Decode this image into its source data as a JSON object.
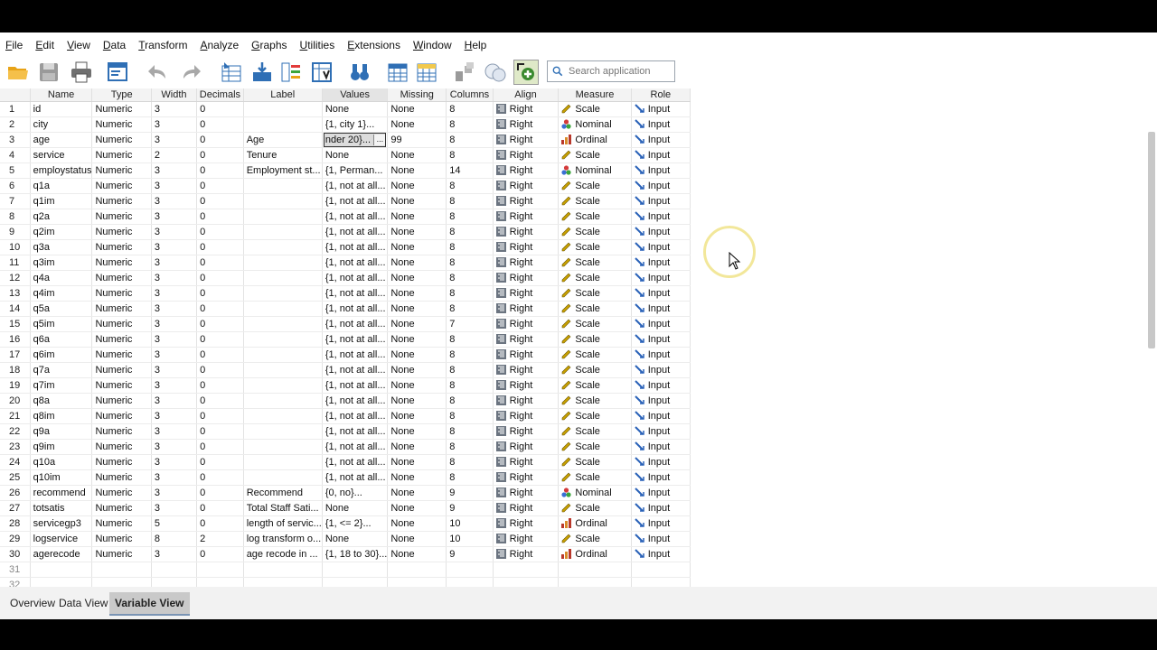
{
  "menu": [
    "File",
    "Edit",
    "View",
    "Data",
    "Transform",
    "Analyze",
    "Graphs",
    "Utilities",
    "Extensions",
    "Window",
    "Help"
  ],
  "search": {
    "placeholder": "Search application"
  },
  "columns": [
    "Name",
    "Type",
    "Width",
    "Decimals",
    "Label",
    "Values",
    "Missing",
    "Columns",
    "Align",
    "Measure",
    "Role"
  ],
  "rows": [
    {
      "n": "1",
      "name": "id",
      "type": "Numeric",
      "width": "3",
      "decimals": "0",
      "label": "",
      "values": "None",
      "missing": "None",
      "columns": "8",
      "align": "Right",
      "measure": "Scale",
      "role": "Input"
    },
    {
      "n": "2",
      "name": "city",
      "type": "Numeric",
      "width": "3",
      "decimals": "0",
      "label": "",
      "values": "{1, city 1}...",
      "missing": "None",
      "columns": "8",
      "align": "Right",
      "measure": "Nominal",
      "role": "Input"
    },
    {
      "n": "3",
      "name": "age",
      "type": "Numeric",
      "width": "3",
      "decimals": "0",
      "label": "Age",
      "values": "nder 20}...",
      "missing": "99",
      "columns": "8",
      "align": "Right",
      "measure": "Ordinal",
      "role": "Input"
    },
    {
      "n": "4",
      "name": "service",
      "type": "Numeric",
      "width": "2",
      "decimals": "0",
      "label": "Tenure",
      "values": "None",
      "missing": "None",
      "columns": "8",
      "align": "Right",
      "measure": "Scale",
      "role": "Input"
    },
    {
      "n": "5",
      "name": "employstatus",
      "type": "Numeric",
      "width": "3",
      "decimals": "0",
      "label": "Employment st...",
      "values": "{1, Perman...",
      "missing": "None",
      "columns": "14",
      "align": "Right",
      "measure": "Nominal",
      "role": "Input"
    },
    {
      "n": "6",
      "name": "q1a",
      "type": "Numeric",
      "width": "3",
      "decimals": "0",
      "label": "",
      "values": "{1, not at all...",
      "missing": "None",
      "columns": "8",
      "align": "Right",
      "measure": "Scale",
      "role": "Input"
    },
    {
      "n": "7",
      "name": "q1im",
      "type": "Numeric",
      "width": "3",
      "decimals": "0",
      "label": "",
      "values": "{1, not at all...",
      "missing": "None",
      "columns": "8",
      "align": "Right",
      "measure": "Scale",
      "role": "Input"
    },
    {
      "n": "8",
      "name": "q2a",
      "type": "Numeric",
      "width": "3",
      "decimals": "0",
      "label": "",
      "values": "{1, not at all...",
      "missing": "None",
      "columns": "8",
      "align": "Right",
      "measure": "Scale",
      "role": "Input"
    },
    {
      "n": "9",
      "name": "q2im",
      "type": "Numeric",
      "width": "3",
      "decimals": "0",
      "label": "",
      "values": "{1, not at all...",
      "missing": "None",
      "columns": "8",
      "align": "Right",
      "measure": "Scale",
      "role": "Input"
    },
    {
      "n": "10",
      "name": "q3a",
      "type": "Numeric",
      "width": "3",
      "decimals": "0",
      "label": "",
      "values": "{1, not at all...",
      "missing": "None",
      "columns": "8",
      "align": "Right",
      "measure": "Scale",
      "role": "Input"
    },
    {
      "n": "11",
      "name": "q3im",
      "type": "Numeric",
      "width": "3",
      "decimals": "0",
      "label": "",
      "values": "{1, not at all...",
      "missing": "None",
      "columns": "8",
      "align": "Right",
      "measure": "Scale",
      "role": "Input"
    },
    {
      "n": "12",
      "name": "q4a",
      "type": "Numeric",
      "width": "3",
      "decimals": "0",
      "label": "",
      "values": "{1, not at all...",
      "missing": "None",
      "columns": "8",
      "align": "Right",
      "measure": "Scale",
      "role": "Input"
    },
    {
      "n": "13",
      "name": "q4im",
      "type": "Numeric",
      "width": "3",
      "decimals": "0",
      "label": "",
      "values": "{1, not at all...",
      "missing": "None",
      "columns": "8",
      "align": "Right",
      "measure": "Scale",
      "role": "Input"
    },
    {
      "n": "14",
      "name": "q5a",
      "type": "Numeric",
      "width": "3",
      "decimals": "0",
      "label": "",
      "values": "{1, not at all...",
      "missing": "None",
      "columns": "8",
      "align": "Right",
      "measure": "Scale",
      "role": "Input"
    },
    {
      "n": "15",
      "name": "q5im",
      "type": "Numeric",
      "width": "3",
      "decimals": "0",
      "label": "",
      "values": "{1, not at all...",
      "missing": "None",
      "columns": "7",
      "align": "Right",
      "measure": "Scale",
      "role": "Input"
    },
    {
      "n": "16",
      "name": "q6a",
      "type": "Numeric",
      "width": "3",
      "decimals": "0",
      "label": "",
      "values": "{1, not at all...",
      "missing": "None",
      "columns": "8",
      "align": "Right",
      "measure": "Scale",
      "role": "Input"
    },
    {
      "n": "17",
      "name": "q6im",
      "type": "Numeric",
      "width": "3",
      "decimals": "0",
      "label": "",
      "values": "{1, not at all...",
      "missing": "None",
      "columns": "8",
      "align": "Right",
      "measure": "Scale",
      "role": "Input"
    },
    {
      "n": "18",
      "name": "q7a",
      "type": "Numeric",
      "width": "3",
      "decimals": "0",
      "label": "",
      "values": "{1, not at all...",
      "missing": "None",
      "columns": "8",
      "align": "Right",
      "measure": "Scale",
      "role": "Input"
    },
    {
      "n": "19",
      "name": "q7im",
      "type": "Numeric",
      "width": "3",
      "decimals": "0",
      "label": "",
      "values": "{1, not at all...",
      "missing": "None",
      "columns": "8",
      "align": "Right",
      "measure": "Scale",
      "role": "Input"
    },
    {
      "n": "20",
      "name": "q8a",
      "type": "Numeric",
      "width": "3",
      "decimals": "0",
      "label": "",
      "values": "{1, not at all...",
      "missing": "None",
      "columns": "8",
      "align": "Right",
      "measure": "Scale",
      "role": "Input"
    },
    {
      "n": "21",
      "name": "q8im",
      "type": "Numeric",
      "width": "3",
      "decimals": "0",
      "label": "",
      "values": "{1, not at all...",
      "missing": "None",
      "columns": "8",
      "align": "Right",
      "measure": "Scale",
      "role": "Input"
    },
    {
      "n": "22",
      "name": "q9a",
      "type": "Numeric",
      "width": "3",
      "decimals": "0",
      "label": "",
      "values": "{1, not at all...",
      "missing": "None",
      "columns": "8",
      "align": "Right",
      "measure": "Scale",
      "role": "Input"
    },
    {
      "n": "23",
      "name": "q9im",
      "type": "Numeric",
      "width": "3",
      "decimals": "0",
      "label": "",
      "values": "{1, not at all...",
      "missing": "None",
      "columns": "8",
      "align": "Right",
      "measure": "Scale",
      "role": "Input"
    },
    {
      "n": "24",
      "name": "q10a",
      "type": "Numeric",
      "width": "3",
      "decimals": "0",
      "label": "",
      "values": "{1, not at all...",
      "missing": "None",
      "columns": "8",
      "align": "Right",
      "measure": "Scale",
      "role": "Input"
    },
    {
      "n": "25",
      "name": "q10im",
      "type": "Numeric",
      "width": "3",
      "decimals": "0",
      "label": "",
      "values": "{1, not at all...",
      "missing": "None",
      "columns": "8",
      "align": "Right",
      "measure": "Scale",
      "role": "Input"
    },
    {
      "n": "26",
      "name": "recommend",
      "type": "Numeric",
      "width": "3",
      "decimals": "0",
      "label": "Recommend",
      "values": "{0, no}...",
      "missing": "None",
      "columns": "9",
      "align": "Right",
      "measure": "Nominal",
      "role": "Input"
    },
    {
      "n": "27",
      "name": "totsatis",
      "type": "Numeric",
      "width": "3",
      "decimals": "0",
      "label": "Total Staff Sati...",
      "values": "None",
      "missing": "None",
      "columns": "9",
      "align": "Right",
      "measure": "Scale",
      "role": "Input"
    },
    {
      "n": "28",
      "name": "servicegp3",
      "type": "Numeric",
      "width": "5",
      "decimals": "0",
      "label": "length of servic...",
      "values": "{1, <= 2}...",
      "missing": "None",
      "columns": "10",
      "align": "Right",
      "measure": "Ordinal",
      "role": "Input"
    },
    {
      "n": "29",
      "name": "logservice",
      "type": "Numeric",
      "width": "8",
      "decimals": "2",
      "label": "log transform o...",
      "values": "None",
      "missing": "None",
      "columns": "10",
      "align": "Right",
      "measure": "Scale",
      "role": "Input"
    },
    {
      "n": "30",
      "name": "agerecode",
      "type": "Numeric",
      "width": "3",
      "decimals": "0",
      "label": "age recode in ...",
      "values": "{1, 18 to 30}...",
      "missing": "None",
      "columns": "9",
      "align": "Right",
      "measure": "Ordinal",
      "role": "Input"
    }
  ],
  "empty_rows": [
    "31",
    "32"
  ],
  "tabs": [
    "Overview",
    "Data View",
    "Variable View"
  ],
  "active_tab": "Variable View",
  "selected_cell": {
    "row": "3",
    "column": "Values"
  },
  "colors": {
    "toolbar_blue": "#2f6fb5",
    "scale_icon": "#c9a100",
    "nominal_red": "#d43b3b",
    "nominal_blue": "#3b6fd4",
    "ordinal_bar": "#b8382b",
    "role_icon": "#2a62b8",
    "active_tab": "#c9c9c9"
  }
}
